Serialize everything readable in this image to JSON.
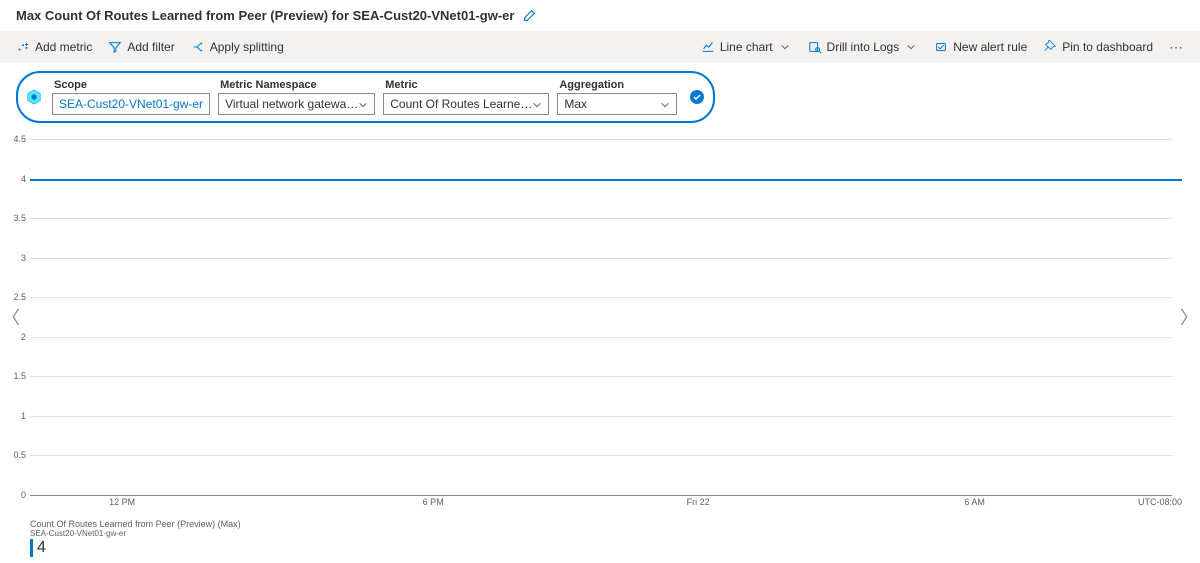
{
  "header": {
    "title": "Max Count Of Routes Learned from Peer (Preview) for SEA-Cust20-VNet01-gw-er"
  },
  "toolbar": {
    "add_metric": "Add metric",
    "add_filter": "Add filter",
    "apply_splitting": "Apply splitting",
    "line_chart": "Line chart",
    "drill_into_logs": "Drill into Logs",
    "new_alert_rule": "New alert rule",
    "pin_to_dashboard": "Pin to dashboard"
  },
  "query": {
    "scope_label": "Scope",
    "scope_value": "SEA-Cust20-VNet01-gw-er",
    "namespace_label": "Metric Namespace",
    "namespace_value": "Virtual network gatewa…",
    "metric_label": "Metric",
    "metric_value": "Count Of Routes Learne…",
    "aggregation_label": "Aggregation",
    "aggregation_value": "Max"
  },
  "chart_data": {
    "type": "line",
    "title": "Max Count Of Routes Learned from Peer (Preview)",
    "ylabel": "",
    "ylim": [
      0,
      4.5
    ],
    "y_ticks": [
      4.5,
      4,
      3.5,
      3,
      2.5,
      2,
      1.5,
      1,
      0.5,
      0
    ],
    "x_ticks": [
      "12 PM",
      "6 PM",
      "Fri 22",
      "6 AM"
    ],
    "timezone": "UTC-08:00",
    "series": [
      {
        "name": "Count Of Routes Learned from Peer (Preview) (Max)",
        "resource": "SEA-Cust20-VNet01-gw-er",
        "value": 4,
        "color": "#0078d4"
      }
    ]
  },
  "legend": {
    "title": "Count Of Routes Learned from Peer (Preview) (Max)",
    "subtitle": "SEA-Cust20-VNet01-gw-er",
    "value": "4"
  }
}
